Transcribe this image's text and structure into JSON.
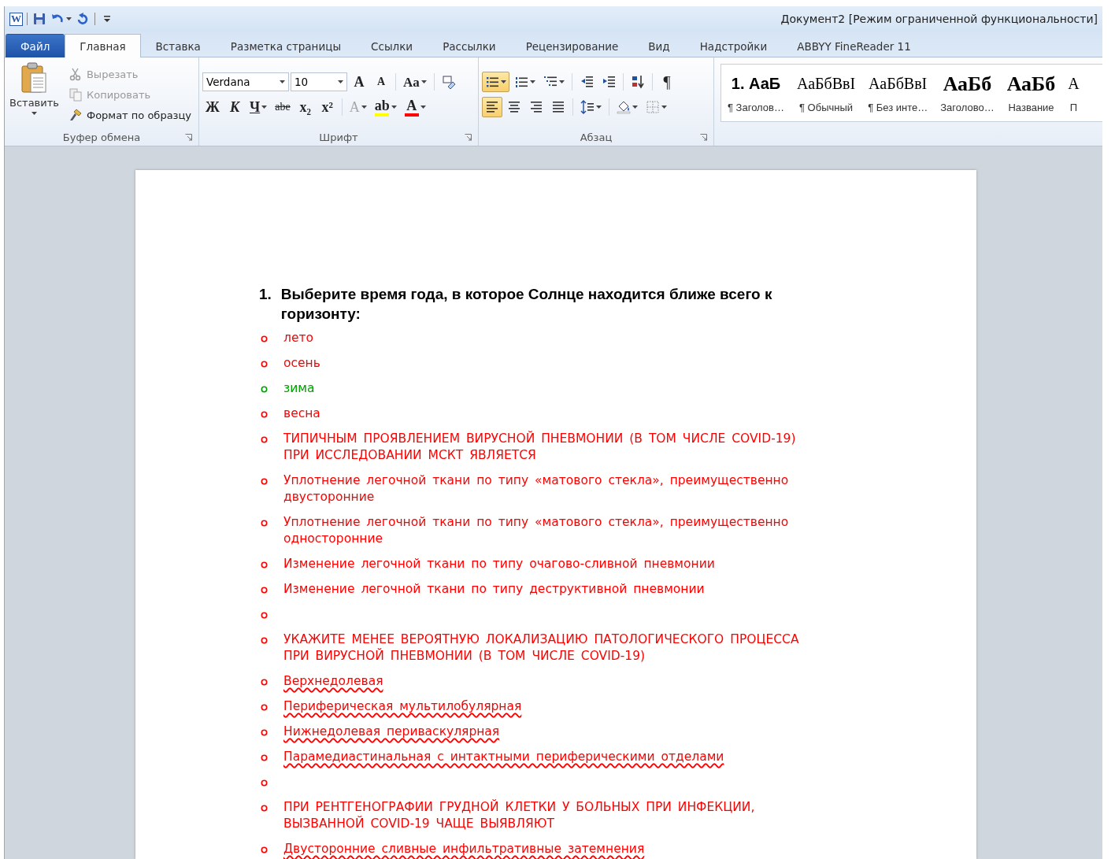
{
  "window": {
    "title": "Документ2 [Режим ограниченной функциональности]"
  },
  "quick_access": [
    {
      "kind": "logo",
      "label": "W"
    },
    {
      "kind": "save"
    },
    {
      "kind": "undo",
      "dropdown": true
    },
    {
      "kind": "redo"
    },
    {
      "kind": "customize"
    }
  ],
  "tabs": [
    {
      "label": "Файл",
      "kind": "file",
      "selected": false
    },
    {
      "label": "Главная",
      "kind": "tab",
      "selected": true
    },
    {
      "label": "Вставка",
      "kind": "tab",
      "selected": false
    },
    {
      "label": "Разметка страницы",
      "kind": "tab",
      "selected": false
    },
    {
      "label": "Ссылки",
      "kind": "tab",
      "selected": false
    },
    {
      "label": "Рассылки",
      "kind": "tab",
      "selected": false
    },
    {
      "label": "Рецензирование",
      "kind": "tab",
      "selected": false
    },
    {
      "label": "Вид",
      "kind": "tab",
      "selected": false
    },
    {
      "label": "Надстройки",
      "kind": "tab",
      "selected": false
    },
    {
      "label": "ABBYY FineReader 11",
      "kind": "tab",
      "selected": false
    }
  ],
  "clipboard": {
    "label": "Буфер обмена",
    "paste": "Вставить",
    "items": [
      {
        "kind": "cut",
        "label": "Вырезать",
        "disabled": true
      },
      {
        "kind": "copy",
        "label": "Копировать",
        "disabled": true
      },
      {
        "kind": "format-painter",
        "label": "Формат по образцу",
        "disabled": false
      }
    ]
  },
  "font": {
    "label": "Шрифт",
    "font_name": "Verdana",
    "font_size": "10",
    "row1": [
      {
        "kind": "grow-font",
        "label": "A"
      },
      {
        "kind": "shrink-font",
        "label": "A"
      },
      {
        "kind": "change-case",
        "label": "Aa",
        "dropdown": true
      },
      {
        "kind": "clear-format"
      }
    ],
    "row2": [
      {
        "kind": "bold",
        "label": "Ж",
        "disabled": false
      },
      {
        "kind": "italic",
        "label": "К",
        "disabled": false
      },
      {
        "kind": "underline",
        "label": "Ч",
        "dropdown": true,
        "disabled": false
      },
      {
        "kind": "strikethrough",
        "label": "abe",
        "disabled": false
      },
      {
        "kind": "subscript",
        "label": "x₂",
        "disabled": false
      },
      {
        "kind": "superscript",
        "label": "x²",
        "disabled": false
      },
      {
        "kind": "text-effects",
        "label": "A",
        "dropdown": true,
        "disabled": true
      },
      {
        "kind": "highlight",
        "label": "ab",
        "dropdown": true,
        "disabled": false
      },
      {
        "kind": "font-color",
        "label": "A",
        "dropdown": true,
        "disabled": false
      }
    ]
  },
  "paragraph": {
    "label": "Абзац",
    "row1": [
      {
        "kind": "bullets",
        "dropdown": true,
        "selected": true
      },
      {
        "kind": "numbering",
        "dropdown": true,
        "selected": false
      },
      {
        "kind": "multilevel",
        "dropdown": true,
        "selected": false
      },
      {
        "kind": "outdent",
        "selected": false
      },
      {
        "kind": "indent",
        "selected": false
      },
      {
        "kind": "sort",
        "selected": false
      },
      {
        "kind": "pilcrow",
        "label": "¶",
        "selected": false
      }
    ],
    "row2": [
      {
        "kind": "align-left",
        "selected": true
      },
      {
        "kind": "align-center",
        "selected": false
      },
      {
        "kind": "align-right",
        "selected": false
      },
      {
        "kind": "justify",
        "selected": false
      },
      {
        "kind": "line-spacing",
        "dropdown": true,
        "selected": false
      },
      {
        "kind": "shading",
        "dropdown": true,
        "selected": false
      },
      {
        "kind": "borders",
        "dropdown": true,
        "selected": false
      }
    ]
  },
  "styles": [
    {
      "kind": "heading-sans",
      "preview": "1. АаБ",
      "name": "¶ Заголов…"
    },
    {
      "kind": "serif",
      "preview": "АаБбВвI",
      "name": "¶ Обычный"
    },
    {
      "kind": "serif",
      "preview": "АаБбВвI",
      "name": "¶ Без инте…"
    },
    {
      "kind": "serif-large",
      "preview": "АаБб",
      "name": "Заголово…"
    },
    {
      "kind": "serif-large",
      "preview": "АаБб",
      "name": "Название"
    },
    {
      "kind": "serif",
      "preview": "А",
      "name": "П"
    }
  ],
  "document": {
    "question": {
      "number": "1.",
      "text": "Выберите время года, в которое Солнце находится ближе всего к горизонту:"
    },
    "items": [
      {
        "text": "лето",
        "color": "#ff0000",
        "misspelled": false
      },
      {
        "text": "осень",
        "color": "#ff0000",
        "misspelled": false
      },
      {
        "text": "зима",
        "color": "#00a000",
        "misspelled": false
      },
      {
        "text": "весна",
        "color": "#ff0000",
        "misspelled": false
      },
      {
        "text": "ТИПИЧНЫМ ПРОЯВЛЕНИЕМ ВИРУСНОЙ ПНЕВМОНИИ (В ТОМ ЧИСЛЕ COVID-19) ПРИ ИССЛЕДОВАНИИ МСКТ ЯВЛЯЕТСЯ",
        "color": "#ff0000",
        "misspelled": false
      },
      {
        "text": "Уплотнение легочной ткани по типу «матового стекла», преимущественно двусторонние",
        "color": "#ff0000",
        "misspelled": false
      },
      {
        "text": "Уплотнение легочной ткани по типу «матового стекла», преимущественно односторонние",
        "color": "#ff0000",
        "misspelled": false
      },
      {
        "text": "Изменение легочной ткани по типу очагово-сливной пневмонии",
        "color": "#ff0000",
        "misspelled": false
      },
      {
        "text": "Изменение легочной ткани по типу деструктивной пневмонии",
        "color": "#ff0000",
        "misspelled": false
      },
      {
        "color": "#ff0000"
      },
      {
        "text": "УКАЖИТЕ МЕНЕЕ ВЕРОЯТНУЮ ЛОКАЛИЗАЦИЮ ПАТОЛОГИЧЕСКОГО ПРОЦЕССА ПРИ ВИРУСНОЙ ПНЕВМОНИИ (В ТОМ ЧИСЛЕ COVID-19)",
        "color": "#ff0000",
        "misspelled": false
      },
      {
        "text": "Верхнедолевая",
        "color": "#ff0000",
        "misspelled": true
      },
      {
        "text": "Периферическая мультилобулярная",
        "color": "#ff0000",
        "misspelled": true
      },
      {
        "text": "Нижнедолевая периваскулярная",
        "color": "#ff0000",
        "misspelled": true
      },
      {
        "text": "Парамедиастинальная с интактными периферическими отделами",
        "color": "#ff0000",
        "misspelled": true
      },
      {
        "color": "#ff0000"
      },
      {
        "text": "ПРИ РЕНТГЕНОГРАФИИ ГРУДНОЙ КЛЕТКИ У БОЛЬНЫХ ПРИ ИНФЕКЦИИ, ВЫЗВАННОЙ COVID-19 ЧАЩЕ ВЫЯВЛЯЮТ",
        "color": "#ff0000",
        "misspelled": false
      },
      {
        "text": "Двусторонние сливные инфильтративные затемнения",
        "color": "#ff0000",
        "misspelled": true
      }
    ]
  }
}
